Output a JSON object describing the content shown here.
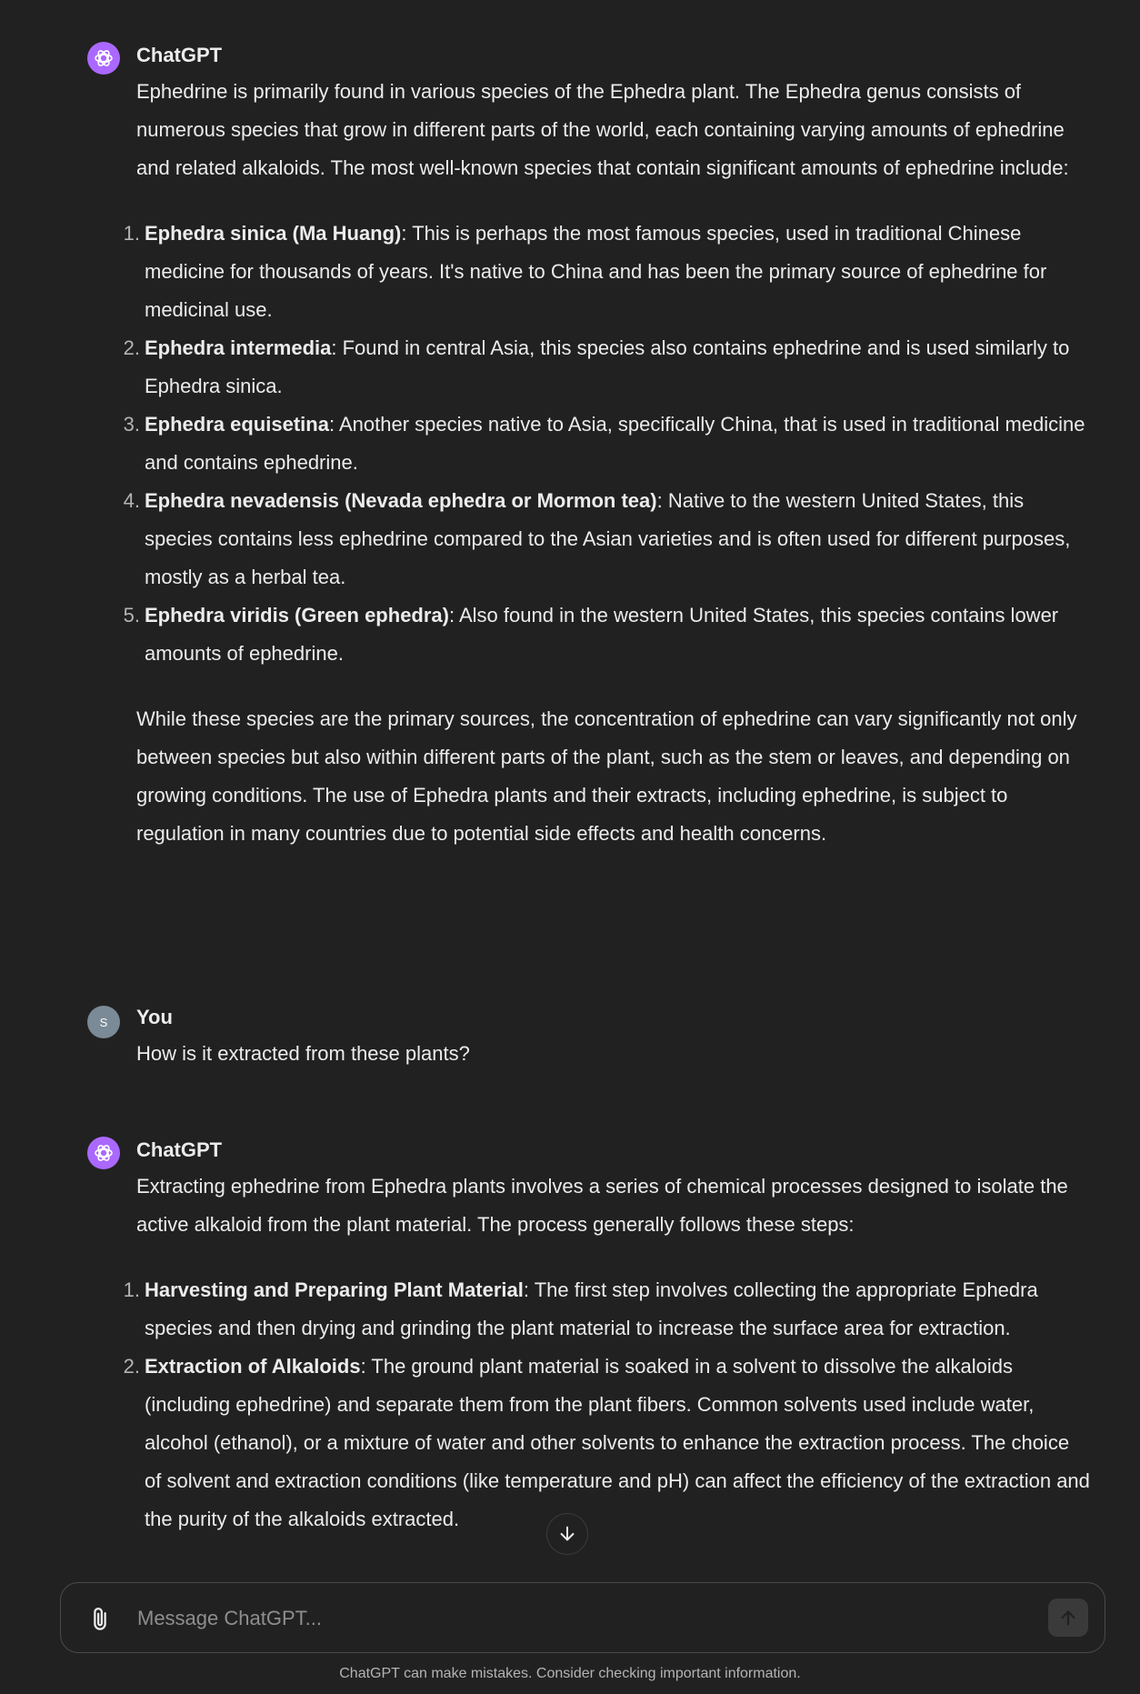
{
  "messages": [
    {
      "author": "ChatGPT",
      "intro": "Ephedrine is primarily found in various species of the Ephedra plant. The Ephedra genus consists of numerous species that grow in different parts of the world, each containing varying amounts of ephedrine and related alkaloids. The most well-known species that contain significant amounts of ephedrine include:",
      "items": [
        {
          "num": "1.",
          "title": "Ephedra sinica (Ma Huang)",
          "text": ": This is perhaps the most famous species, used in traditional Chinese medicine for thousands of years. It's native to China and has been the primary source of ephedrine for medicinal use."
        },
        {
          "num": "2.",
          "title": "Ephedra intermedia",
          "text": ": Found in central Asia, this species also contains ephedrine and is used similarly to Ephedra sinica."
        },
        {
          "num": "3.",
          "title": "Ephedra equisetina",
          "text": ": Another species native to Asia, specifically China, that is used in traditional medicine and contains ephedrine."
        },
        {
          "num": "4.",
          "title": "Ephedra nevadensis (Nevada ephedra or Mormon tea)",
          "text": ": Native to the western United States, this species contains less ephedrine compared to the Asian varieties and is often used for different purposes, mostly as a herbal tea."
        },
        {
          "num": "5.",
          "title": "Ephedra viridis (Green ephedra)",
          "text": ": Also found in the western United States, this species contains lower amounts of ephedrine."
        }
      ],
      "outro": "While these species are the primary sources, the concentration of ephedrine can vary significantly not only between species but also within different parts of the plant, such as the stem or leaves, and depending on growing conditions. The use of Ephedra plants and their extracts, including ephedrine, is subject to regulation in many countries due to potential side effects and health concerns."
    },
    {
      "author": "You",
      "avatar_letter": "S",
      "text": "How is it extracted from these plants?"
    },
    {
      "author": "ChatGPT",
      "intro": "Extracting ephedrine from Ephedra plants involves a series of chemical processes designed to isolate the active alkaloid from the plant material. The process generally follows these steps:",
      "items": [
        {
          "num": "1.",
          "title": "Harvesting and Preparing Plant Material",
          "text": ": The first step involves collecting the appropriate Ephedra species and then drying and grinding the plant material to increase the surface area for extraction."
        },
        {
          "num": "2.",
          "title": "Extraction of Alkaloids",
          "text": ": The ground plant material is soaked in a solvent to dissolve the alkaloids (including ephedrine) and separate them from the plant fibers. Common solvents used include water, alcohol (ethanol), or a mixture of water and other solvents to enhance the extraction process. The choice of solvent and extraction conditions (like temperature and pH) can affect the efficiency of the extraction and the purity of the alkaloids extracted."
        }
      ]
    }
  ],
  "composer": {
    "placeholder": "Message ChatGPT..."
  },
  "disclaimer": "ChatGPT can make mistakes. Consider checking important information.",
  "icons": {
    "gpt_avatar": "openai-logo-icon",
    "attach": "paperclip-icon",
    "send": "arrow-up-icon",
    "scroll": "arrow-down-icon"
  },
  "colors": {
    "background": "#212121",
    "text": "#ececec",
    "gpt_avatar": "#ab68ff",
    "user_avatar": "#7a8a96"
  }
}
